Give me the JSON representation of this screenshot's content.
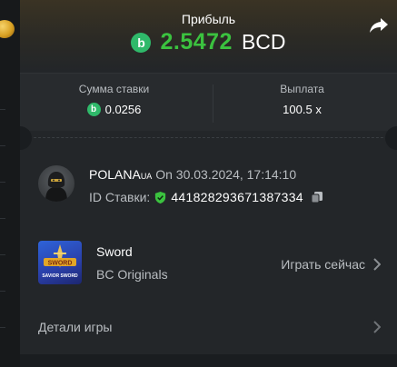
{
  "header": {
    "profit_label": "Прибыль",
    "profit_amount": "2.5472",
    "profit_currency": "BCD",
    "coin_symbol": "b",
    "profit_color": "#3bc23f",
    "coin_color": "#2fb96a"
  },
  "stats": {
    "bet_label": "Сумма ставки",
    "bet_value": "0.0256",
    "payout_label": "Выплата",
    "payout_value": "100.5 x"
  },
  "player": {
    "name": "POLANA",
    "name_suffix": "UA",
    "date_text": " On 30.03.2024, 17:14:10",
    "bet_id_label": "ID Ставки:",
    "bet_id": "441828293671387334"
  },
  "game": {
    "title": "Sword",
    "provider": "BC Originals",
    "play_label": "Играть сейчас",
    "thumb_text_top": "SWORD",
    "thumb_text_bottom": "SAVIOR SWORD"
  },
  "footer": {
    "details_label": "Детали игры"
  },
  "icons": {
    "share": "share-icon",
    "coin": "bcd-coin-icon",
    "shield": "verified-shield-icon",
    "copy": "copy-icon",
    "chevron": "chevron-right-icon"
  }
}
